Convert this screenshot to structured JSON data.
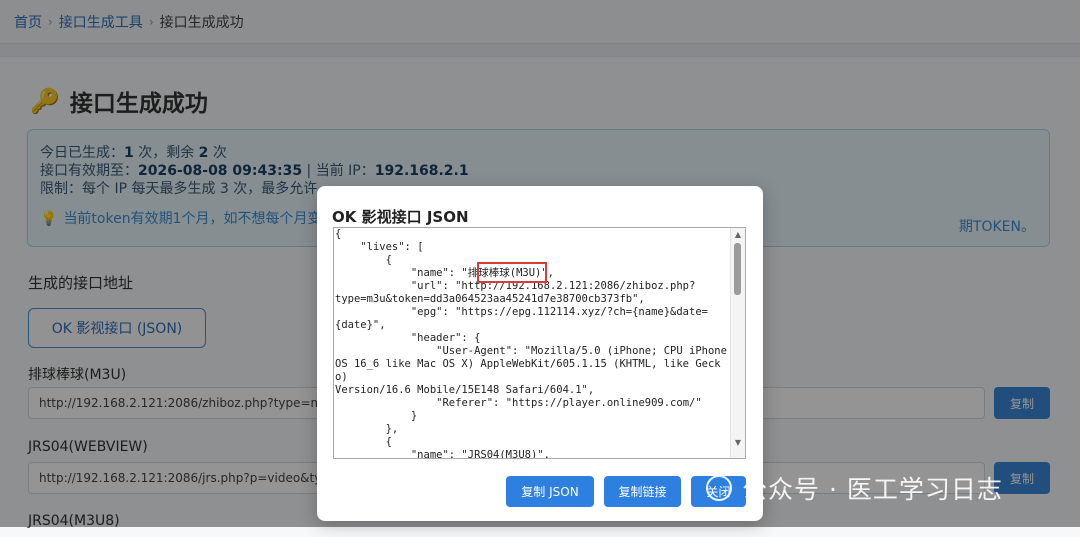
{
  "breadcrumb": {
    "home": "首页",
    "tool": "接口生成工具",
    "current": "接口生成成功"
  },
  "page": {
    "title": "接口生成成功",
    "info": {
      "line1_prefix": "今日已生成：",
      "line1_count": "1",
      "line1_mid": " 次，剩余 ",
      "line1_remaining": "2",
      "line1_suffix": " 次",
      "line2_prefix": "接口有效期至：",
      "line2_expiry": "2026-08-08 09:43:35",
      "line2_mid": " | 当前 IP：",
      "line2_ip": "192.168.2.1",
      "line3": "限制：每个 IP 每天最多生成 3 次，最多允许",
      "tip_left": "当前token有效期1个月，如不想每个月变",
      "tip_right": "期TOKEN。"
    },
    "section_heading": "生成的接口地址",
    "json_button": "OK 影视接口 (JSON)",
    "items": [
      {
        "label": "排球棒球(M3U)",
        "url": "http://192.168.2.121:2086/zhiboz.php?type=m3u&tok",
        "copy": "复制"
      },
      {
        "label": "JRS04(WEBVIEW)",
        "url": "http://192.168.2.121:2086/jrs.php?p=video&type=m3",
        "copy": "复制"
      },
      {
        "label": "JRS04(M3U8)"
      }
    ]
  },
  "modal": {
    "title": "OK 影视接口 JSON",
    "code": "{\n    \"lives\": [\n        {\n            \"name\": \"排球棒球(M3U)\",\n            \"url\": \"http://192.168.2.121:2086/zhiboz.php?\ntype=m3u&token=dd3a064523aa45241d7e38700cb373fb\",\n            \"epg\": \"https://epg.112114.xyz/?ch={name}&date=\n{date}\",\n            \"header\": {\n                \"User-Agent\": \"Mozilla/5.0 (iPhone; CPU iPhone\nOS 16_6 like Mac OS X) AppleWebKit/605.1.15 (KHTML, like Gecko)\nVersion/16.6 Mobile/15E148 Safari/604.1\",\n                \"Referer\": \"https://player.online909.com/\"\n            }\n        },\n        {\n            \"name\": \"JRS04(M3U8)\",",
    "buttons": {
      "copy_json": "复制 JSON",
      "copy_link": "复制链接",
      "close": "关闭"
    }
  },
  "watermark": "公众号 · 医工学习日志",
  "colors": {
    "primary": "#2d7fe0",
    "highlight": "#d93b3b",
    "info_bg": "#e8f4fb"
  }
}
